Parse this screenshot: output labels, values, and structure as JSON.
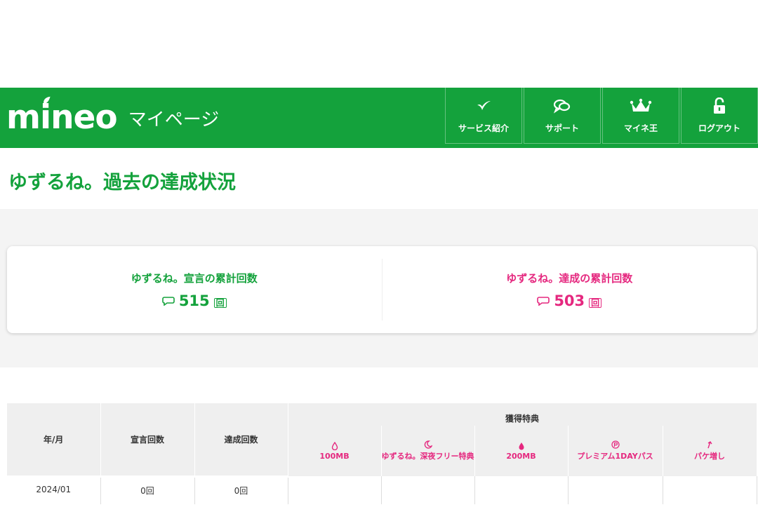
{
  "header": {
    "logo_text": "mineo",
    "subtitle": "マイページ",
    "nav": [
      {
        "label": "サービス紹介",
        "icon": "mineo-leaf-icon"
      },
      {
        "label": "サポート",
        "icon": "chat-bubbles-icon"
      },
      {
        "label": "マイネ王",
        "icon": "crown-icon"
      },
      {
        "label": "ログアウト",
        "icon": "unlock-icon"
      }
    ]
  },
  "page": {
    "title": "ゆずるね。過去の達成状況"
  },
  "summary": {
    "declared": {
      "label": "ゆずるね。宣言の累計回数",
      "value": "515",
      "unit": "回"
    },
    "achieved": {
      "label": "ゆずるね。達成の累計回数",
      "value": "503",
      "unit": "回"
    }
  },
  "table": {
    "headers": {
      "month": "年/月",
      "declared": "宣言回数",
      "achieved": "達成回数",
      "bonus_group": "獲得特典"
    },
    "bonuses": [
      {
        "label": "100MB",
        "icon": "drop-outline-icon"
      },
      {
        "label": "ゆずるね。深夜フリー特典",
        "icon": "moon-icon"
      },
      {
        "label": "200MB",
        "icon": "drop-filled-icon"
      },
      {
        "label": "プレミアム1DAYパス",
        "icon": "premium-circle-icon"
      },
      {
        "label": "パケ増し",
        "icon": "arrow-up-icon"
      }
    ],
    "rows": [
      {
        "month": "2024/01",
        "declared": "0回",
        "achieved": "0回"
      }
    ]
  },
  "colors": {
    "brand_green": "#14a23c",
    "accent_pink": "#e5287f"
  }
}
